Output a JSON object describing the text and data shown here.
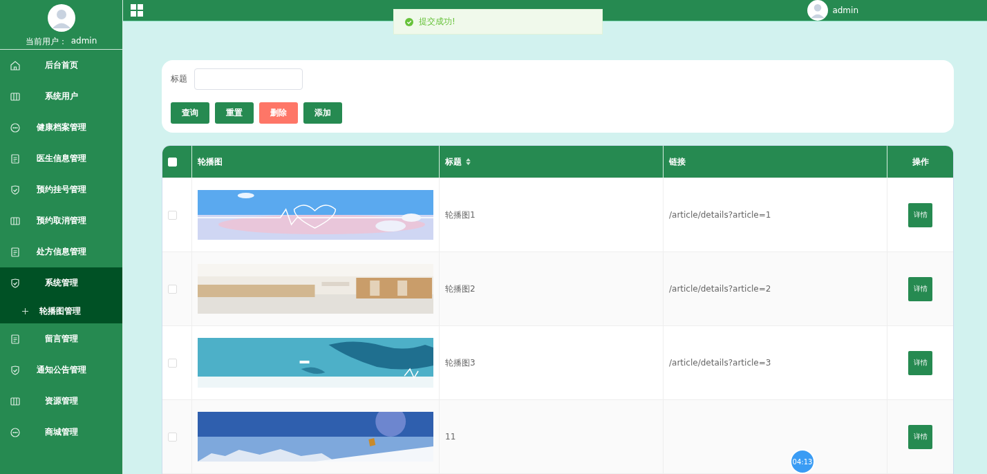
{
  "sidebar": {
    "user_label": "当前用户：",
    "user_name": "admin",
    "items": [
      {
        "label": "后台首页",
        "selected": false
      },
      {
        "label": "系统用户",
        "selected": false
      },
      {
        "label": "健康档案管理",
        "selected": false
      },
      {
        "label": "医生信息管理",
        "selected": false
      },
      {
        "label": "预约挂号管理",
        "selected": false
      },
      {
        "label": "预约取消管理",
        "selected": false
      },
      {
        "label": "处方信息管理",
        "selected": false
      },
      {
        "label": "系统管理",
        "selected": true,
        "children": [
          {
            "label": "轮播图管理",
            "selected": true
          }
        ]
      },
      {
        "label": "留言管理",
        "selected": false
      },
      {
        "label": "通知公告管理",
        "selected": false
      },
      {
        "label": "资源管理",
        "selected": false
      },
      {
        "label": "商城管理",
        "selected": false
      }
    ]
  },
  "header": {
    "user_name": "admin"
  },
  "toast": {
    "message": "提交成功!"
  },
  "search": {
    "label": "标题"
  },
  "buttons": [
    {
      "label": "查询",
      "kind": "primary"
    },
    {
      "label": "重置",
      "kind": "primary"
    },
    {
      "label": "删除",
      "kind": "danger"
    },
    {
      "label": "添加",
      "kind": "primary"
    }
  ],
  "table": {
    "columns": [
      "轮播图",
      "标题",
      "链接",
      "操作"
    ],
    "select_all_checked": false,
    "rows": [
      {
        "checked": false,
        "title": "轮播图1",
        "link": "/article/details?article=1",
        "action": "详情"
      },
      {
        "checked": false,
        "title": "轮播图2",
        "link": "/article/details?article=2",
        "action": "详情"
      },
      {
        "checked": false,
        "title": "轮播图3",
        "link": "/article/details?article=3",
        "action": "详情"
      },
      {
        "checked": false,
        "title": "11",
        "action": "详情"
      }
    ]
  },
  "timer": "04:13"
}
